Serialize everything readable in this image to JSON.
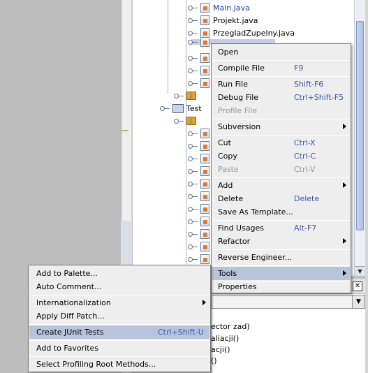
{
  "tree": {
    "files_top": [
      "Main.java",
      "Projekt.java",
      "PrzegladZupelny.java"
    ],
    "test_node_label": "Test"
  },
  "context_menu": {
    "items": [
      {
        "label": "Open",
        "shortcut": ""
      },
      {
        "label": "Compile File",
        "shortcut": "F9"
      },
      {
        "label": "Run File",
        "shortcut": "Shift-F6"
      },
      {
        "label": "Debug File",
        "shortcut": "Ctrl+Shift-F5"
      },
      {
        "label": "Profile File",
        "shortcut": ""
      },
      {
        "label": "Subversion",
        "shortcut": ""
      },
      {
        "label": "Cut",
        "shortcut": "Ctrl-X"
      },
      {
        "label": "Copy",
        "shortcut": "Ctrl-C"
      },
      {
        "label": "Paste",
        "shortcut": "Ctrl-V"
      },
      {
        "label": "Add",
        "shortcut": ""
      },
      {
        "label": "Delete",
        "shortcut": "Delete"
      },
      {
        "label": "Save As Template...",
        "shortcut": ""
      },
      {
        "label": "Find Usages",
        "shortcut": "Alt-F7"
      },
      {
        "label": "Refactor",
        "shortcut": ""
      },
      {
        "label": "Reverse Engineer...",
        "shortcut": ""
      },
      {
        "label": "Tools",
        "shortcut": ""
      },
      {
        "label": "Properties",
        "shortcut": ""
      }
    ]
  },
  "tools_submenu": {
    "items": [
      {
        "label": "Add to Palette...",
        "shortcut": ""
      },
      {
        "label": "Auto Comment...",
        "shortcut": ""
      },
      {
        "label": "Internationalization",
        "shortcut": ""
      },
      {
        "label": "Apply Diff Patch...",
        "shortcut": ""
      },
      {
        "label": "Create JUnit Tests",
        "shortcut": "Ctrl+Shift-U"
      },
      {
        "label": "Add to Favorites",
        "shortcut": ""
      },
      {
        "label": "Select Profiling Root Methods...",
        "shortcut": ""
      }
    ]
  },
  "navigator": {
    "lines": [
      "ector zad)",
      "aliacji()",
      "acji()",
      "()"
    ]
  },
  "colors": {
    "menu_bg": "#eeeeee",
    "highlight": "#b8c4dc",
    "shortcut": "#3c56a8"
  }
}
